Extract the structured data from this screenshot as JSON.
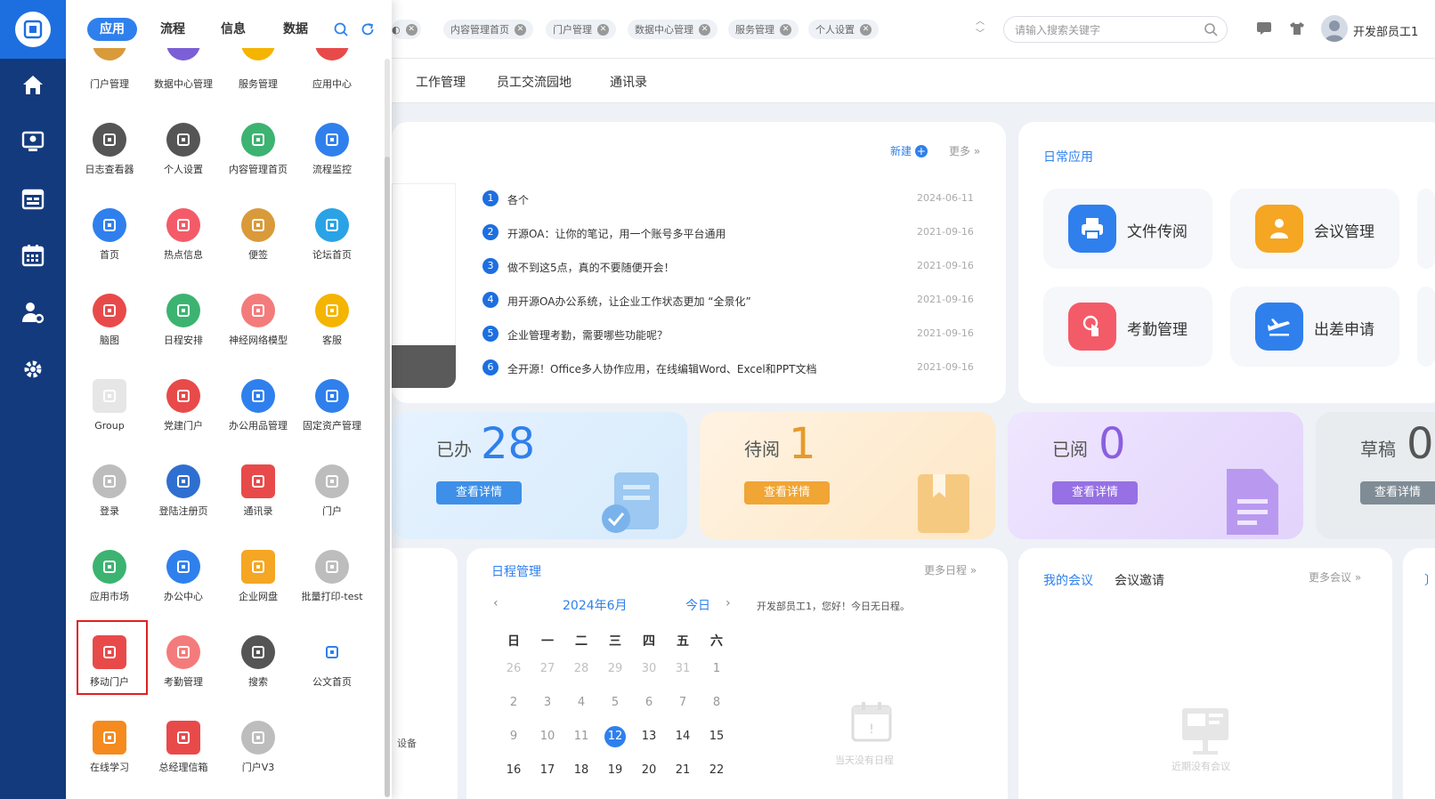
{
  "topbar": {
    "tabs": [
      {
        "label": "内容管理首页"
      },
      {
        "label": "门户管理"
      },
      {
        "label": "数据中心管理"
      },
      {
        "label": "服务管理"
      },
      {
        "label": "个人设置"
      }
    ],
    "search_placeholder": "请输入搜索关键字",
    "user_name": "开发部员工1"
  },
  "subtabs": [
    "工作管理",
    "员工交流园地",
    "通讯录"
  ],
  "news": {
    "new_label": "新建",
    "more_label": "更多",
    "items": [
      {
        "num": "1",
        "title": "各个",
        "date": "2024-06-11"
      },
      {
        "num": "2",
        "title": "开源OA：让你的笔记，用一个账号多平台通用",
        "date": "2021-09-16"
      },
      {
        "num": "3",
        "title": "做不到这5点，真的不要随便开会！",
        "date": "2021-09-16"
      },
      {
        "num": "4",
        "title": "用开源OA办公系统，让企业工作状态更加 “全景化”",
        "date": "2021-09-16"
      },
      {
        "num": "5",
        "title": "企业管理考勤，需要哪些功能呢？",
        "date": "2021-09-16"
      },
      {
        "num": "6",
        "title": "全开源！Office多人协作应用，在线编辑Word、Excel和PPT文档",
        "date": "2021-09-16"
      }
    ]
  },
  "daily_apps": {
    "title": "日常应用",
    "items": [
      {
        "label": "文件传阅",
        "color": "#2f80ed"
      },
      {
        "label": "会议管理",
        "color": "#f5a623"
      },
      {
        "label": "考勤管理",
        "color": "#f45b69"
      },
      {
        "label": "出差申请",
        "color": "#2f80ed"
      }
    ]
  },
  "stats": [
    {
      "label": "已办",
      "value": "28",
      "button": "查看详情"
    },
    {
      "label": "待阅",
      "value": "1",
      "button": "查看详情"
    },
    {
      "label": "已阅",
      "value": "0",
      "button": "查看详情"
    },
    {
      "label": "草稿",
      "value": "0",
      "button": "查看详情"
    }
  ],
  "schedule": {
    "title": "日程管理",
    "more": "更多日程",
    "month": "2024年6月",
    "today": "今日",
    "greeting": "开发部员工1，您好！今日无日程。",
    "empty": "当天没有日程",
    "weekdays": [
      "日",
      "一",
      "二",
      "三",
      "四",
      "五",
      "六"
    ],
    "rows": [
      [
        "26",
        "27",
        "28",
        "29",
        "30",
        "31",
        "1"
      ],
      [
        "2",
        "3",
        "4",
        "5",
        "6",
        "7",
        "8"
      ],
      [
        "9",
        "10",
        "11",
        "12",
        "13",
        "14",
        "15"
      ],
      [
        "16",
        "17",
        "18",
        "19",
        "20",
        "21",
        "22"
      ]
    ],
    "selected": "12"
  },
  "meeting": {
    "tab_mine": "我的会议",
    "tab_invite": "会议邀请",
    "more": "更多会议",
    "empty": "近期没有会议"
  },
  "left_snippet": "设备",
  "drawer": {
    "tabs": [
      "应用",
      "流程",
      "信息",
      "数据"
    ],
    "top_partial": [
      "门户管理",
      "数据中心管理",
      "服务管理",
      "应用中心"
    ],
    "apps": [
      {
        "label": "日志查看器",
        "color": "#555555"
      },
      {
        "label": "个人设置",
        "color": "#555555"
      },
      {
        "label": "内容管理首页",
        "color": "#3cb371"
      },
      {
        "label": "流程监控",
        "color": "#2f80ed"
      },
      {
        "label": "首页",
        "color": "#2f80ed"
      },
      {
        "label": "热点信息",
        "color": "#f45b69"
      },
      {
        "label": "便签",
        "color": "#d99a3a"
      },
      {
        "label": "论坛首页",
        "color": "#2aa3e6"
      },
      {
        "label": "脑图",
        "color": "#e84a4a"
      },
      {
        "label": "日程安排",
        "color": "#3cb371"
      },
      {
        "label": "神经网络模型",
        "color": "#f47b7b"
      },
      {
        "label": "客服",
        "color": "#f5b400"
      },
      {
        "label": "Group",
        "color": "#e6e6e6"
      },
      {
        "label": "党建门户",
        "color": "#e84a4a"
      },
      {
        "label": "办公用品管理",
        "color": "#2f80ed"
      },
      {
        "label": "固定资产管理",
        "color": "#2f80ed"
      },
      {
        "label": "登录",
        "color": "#bdbdbd"
      },
      {
        "label": "登陆注册页",
        "color": "#2f6fd0"
      },
      {
        "label": "通讯录",
        "color": "#e84a4a"
      },
      {
        "label": "门户",
        "color": "#bdbdbd"
      },
      {
        "label": "应用市场",
        "color": "#3cb371"
      },
      {
        "label": "办公中心",
        "color": "#2f80ed"
      },
      {
        "label": "企业网盘",
        "color": "#f5a623"
      },
      {
        "label": "批量打印-test",
        "color": "#bdbdbd"
      },
      {
        "label": "移动门户",
        "color": "#e84a4a"
      },
      {
        "label": "考勤管理",
        "color": "#f47b7b"
      },
      {
        "label": "搜索",
        "color": "#555555"
      },
      {
        "label": "公文首页",
        "color": "#ffffff"
      },
      {
        "label": "在线学习",
        "color": "#f58a1f"
      },
      {
        "label": "总经理信箱",
        "color": "#e84a4a"
      },
      {
        "label": "门户V3",
        "color": "#bdbdbd"
      }
    ]
  }
}
